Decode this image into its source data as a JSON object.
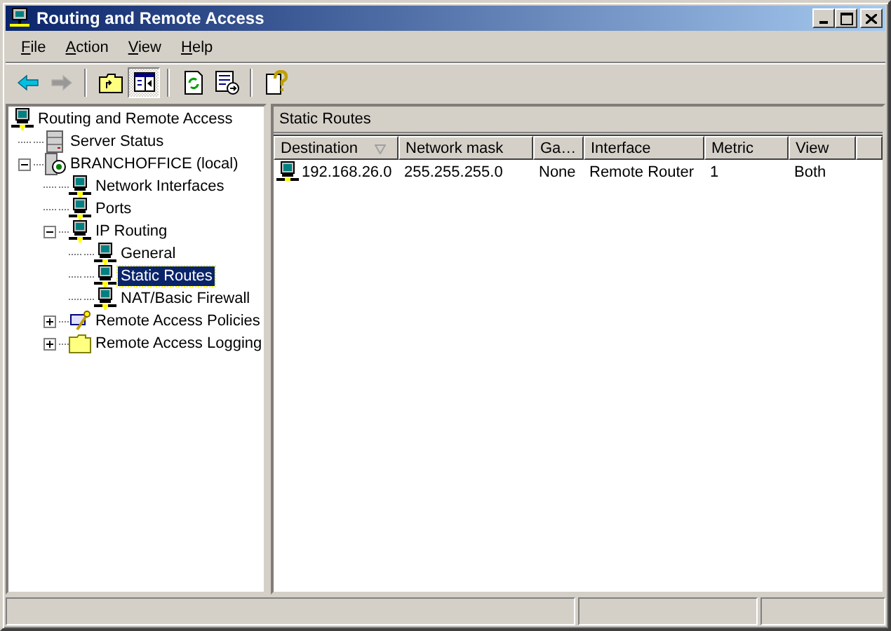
{
  "window": {
    "title": "Routing and Remote Access"
  },
  "menu": [
    {
      "label": "File"
    },
    {
      "label": "Action"
    },
    {
      "label": "View"
    },
    {
      "label": "Help"
    }
  ],
  "toolbar": [
    {
      "kind": "back",
      "disabled": false,
      "pressed": false
    },
    {
      "kind": "forward",
      "disabled": true,
      "pressed": false
    },
    {
      "kind": "separator"
    },
    {
      "kind": "up",
      "disabled": false,
      "pressed": false
    },
    {
      "kind": "tree",
      "disabled": false,
      "pressed": true
    },
    {
      "kind": "separator"
    },
    {
      "kind": "refresh",
      "disabled": false,
      "pressed": false
    },
    {
      "kind": "export",
      "disabled": false,
      "pressed": false
    },
    {
      "kind": "separator"
    },
    {
      "kind": "help",
      "disabled": false,
      "pressed": false
    }
  ],
  "tree": [
    {
      "label": "Routing and Remote Access",
      "kind": "computer",
      "selected": false,
      "children": [
        {
          "label": "Server Status",
          "kind": "server",
          "selected": false
        },
        {
          "label": "BRANCHOFFICE (local)",
          "kind": "branch",
          "selected": false,
          "expanded": true,
          "children": [
            {
              "label": "Network Interfaces",
              "kind": "computer",
              "selected": false
            },
            {
              "label": "Ports",
              "kind": "computer",
              "selected": false
            },
            {
              "label": "IP Routing",
              "kind": "computer",
              "selected": false,
              "expanded": true,
              "children": [
                {
                  "label": "General",
                  "kind": "computer",
                  "selected": false
                },
                {
                  "label": "Static Routes",
                  "kind": "computer",
                  "selected": true
                },
                {
                  "label": "NAT/Basic Firewall",
                  "kind": "computer",
                  "selected": false
                }
              ]
            },
            {
              "label": "Remote Access Policies",
              "kind": "policy",
              "selected": false,
              "expanded": false
            },
            {
              "label": "Remote Access Logging",
              "kind": "folder",
              "selected": false,
              "expanded": false
            }
          ]
        }
      ]
    }
  ],
  "panel": {
    "title": "Static Routes",
    "columns": [
      {
        "label": "Destination",
        "sorted": true
      },
      {
        "label": "Network mask",
        "sorted": false
      },
      {
        "label": "Ga…",
        "sorted": false
      },
      {
        "label": "Interface",
        "sorted": false
      },
      {
        "label": "Metric",
        "sorted": false
      },
      {
        "label": "View",
        "sorted": false
      }
    ],
    "rows": [
      [
        "192.168.26.0",
        "255.255.255.0",
        "None",
        "Remote Router",
        "1",
        "Both"
      ]
    ]
  }
}
